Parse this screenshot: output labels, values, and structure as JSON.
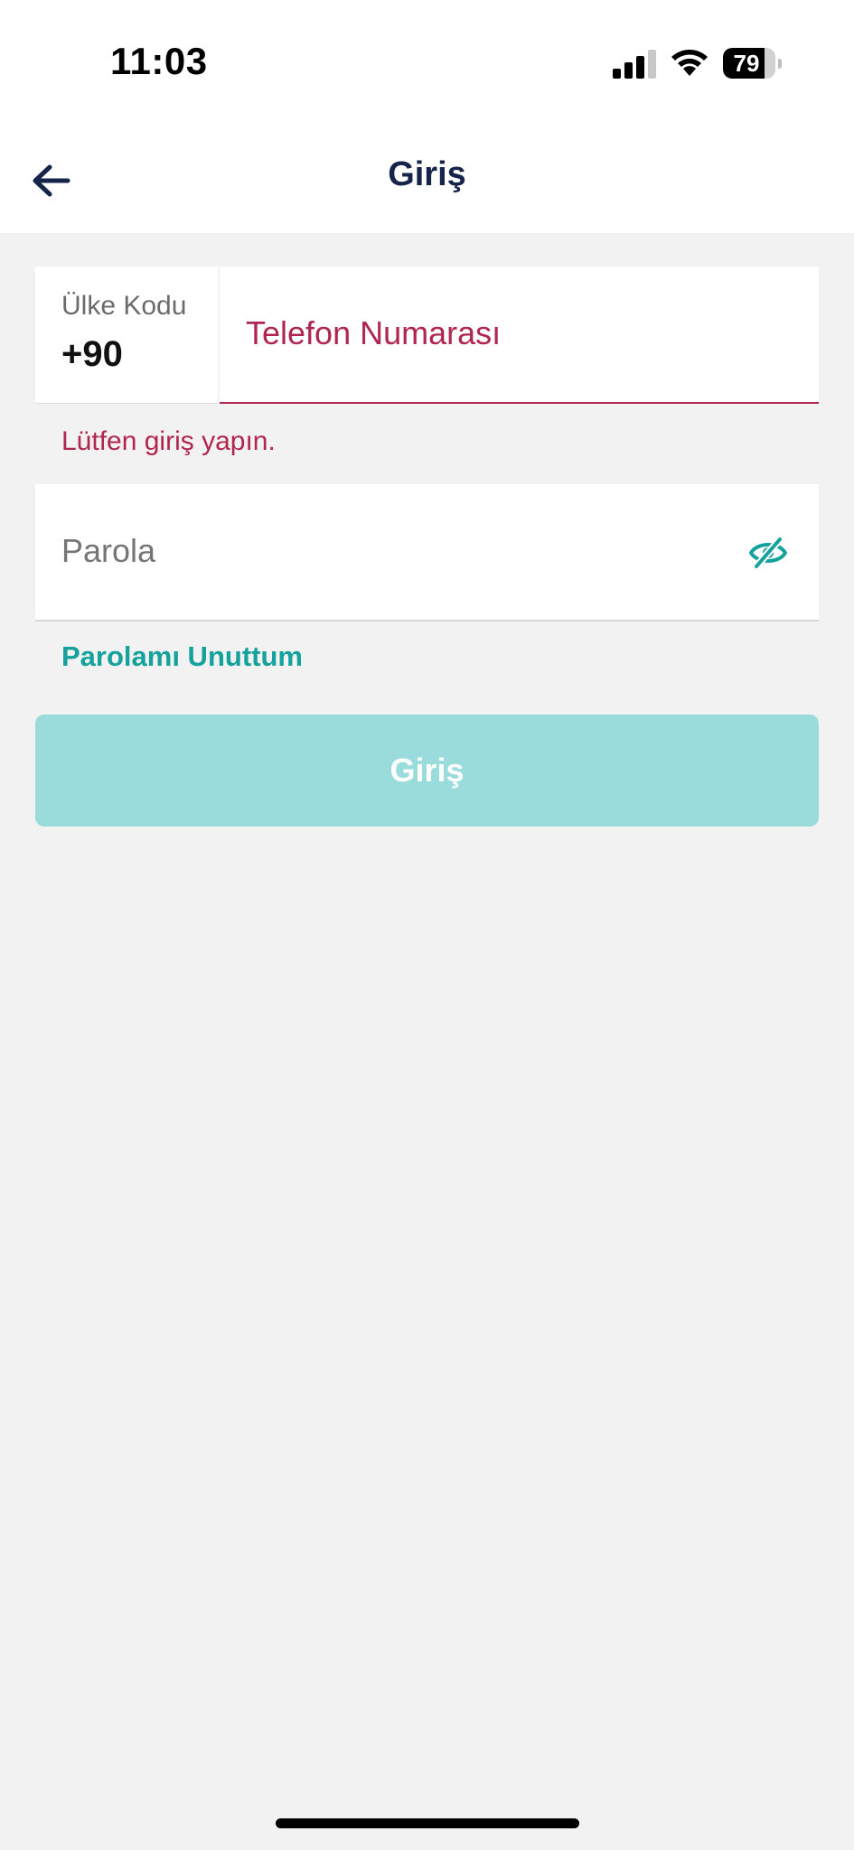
{
  "status_bar": {
    "time": "11:03",
    "battery_level": 79,
    "battery_text": "79",
    "icons": [
      "signal-icon",
      "wifi-icon",
      "battery-icon"
    ]
  },
  "nav": {
    "title": "Giriş",
    "back_icon": "arrow-left-icon"
  },
  "phone": {
    "country_label": "Ülke Kodu",
    "country_code": "+90",
    "placeholder": "Telefon Numarası",
    "value": "",
    "error": "Lütfen giriş yapın."
  },
  "password": {
    "placeholder": "Parola",
    "value": "",
    "visibility_icon": "eye-off-icon"
  },
  "forgot_password": "Parolamı Unuttum",
  "login_button": "Giriş",
  "colors": {
    "primary_teal": "#16a29c",
    "button_disabled": "#9adcdc",
    "error": "#b0264f",
    "navy": "#16244a",
    "background": "#f2f2f2"
  }
}
